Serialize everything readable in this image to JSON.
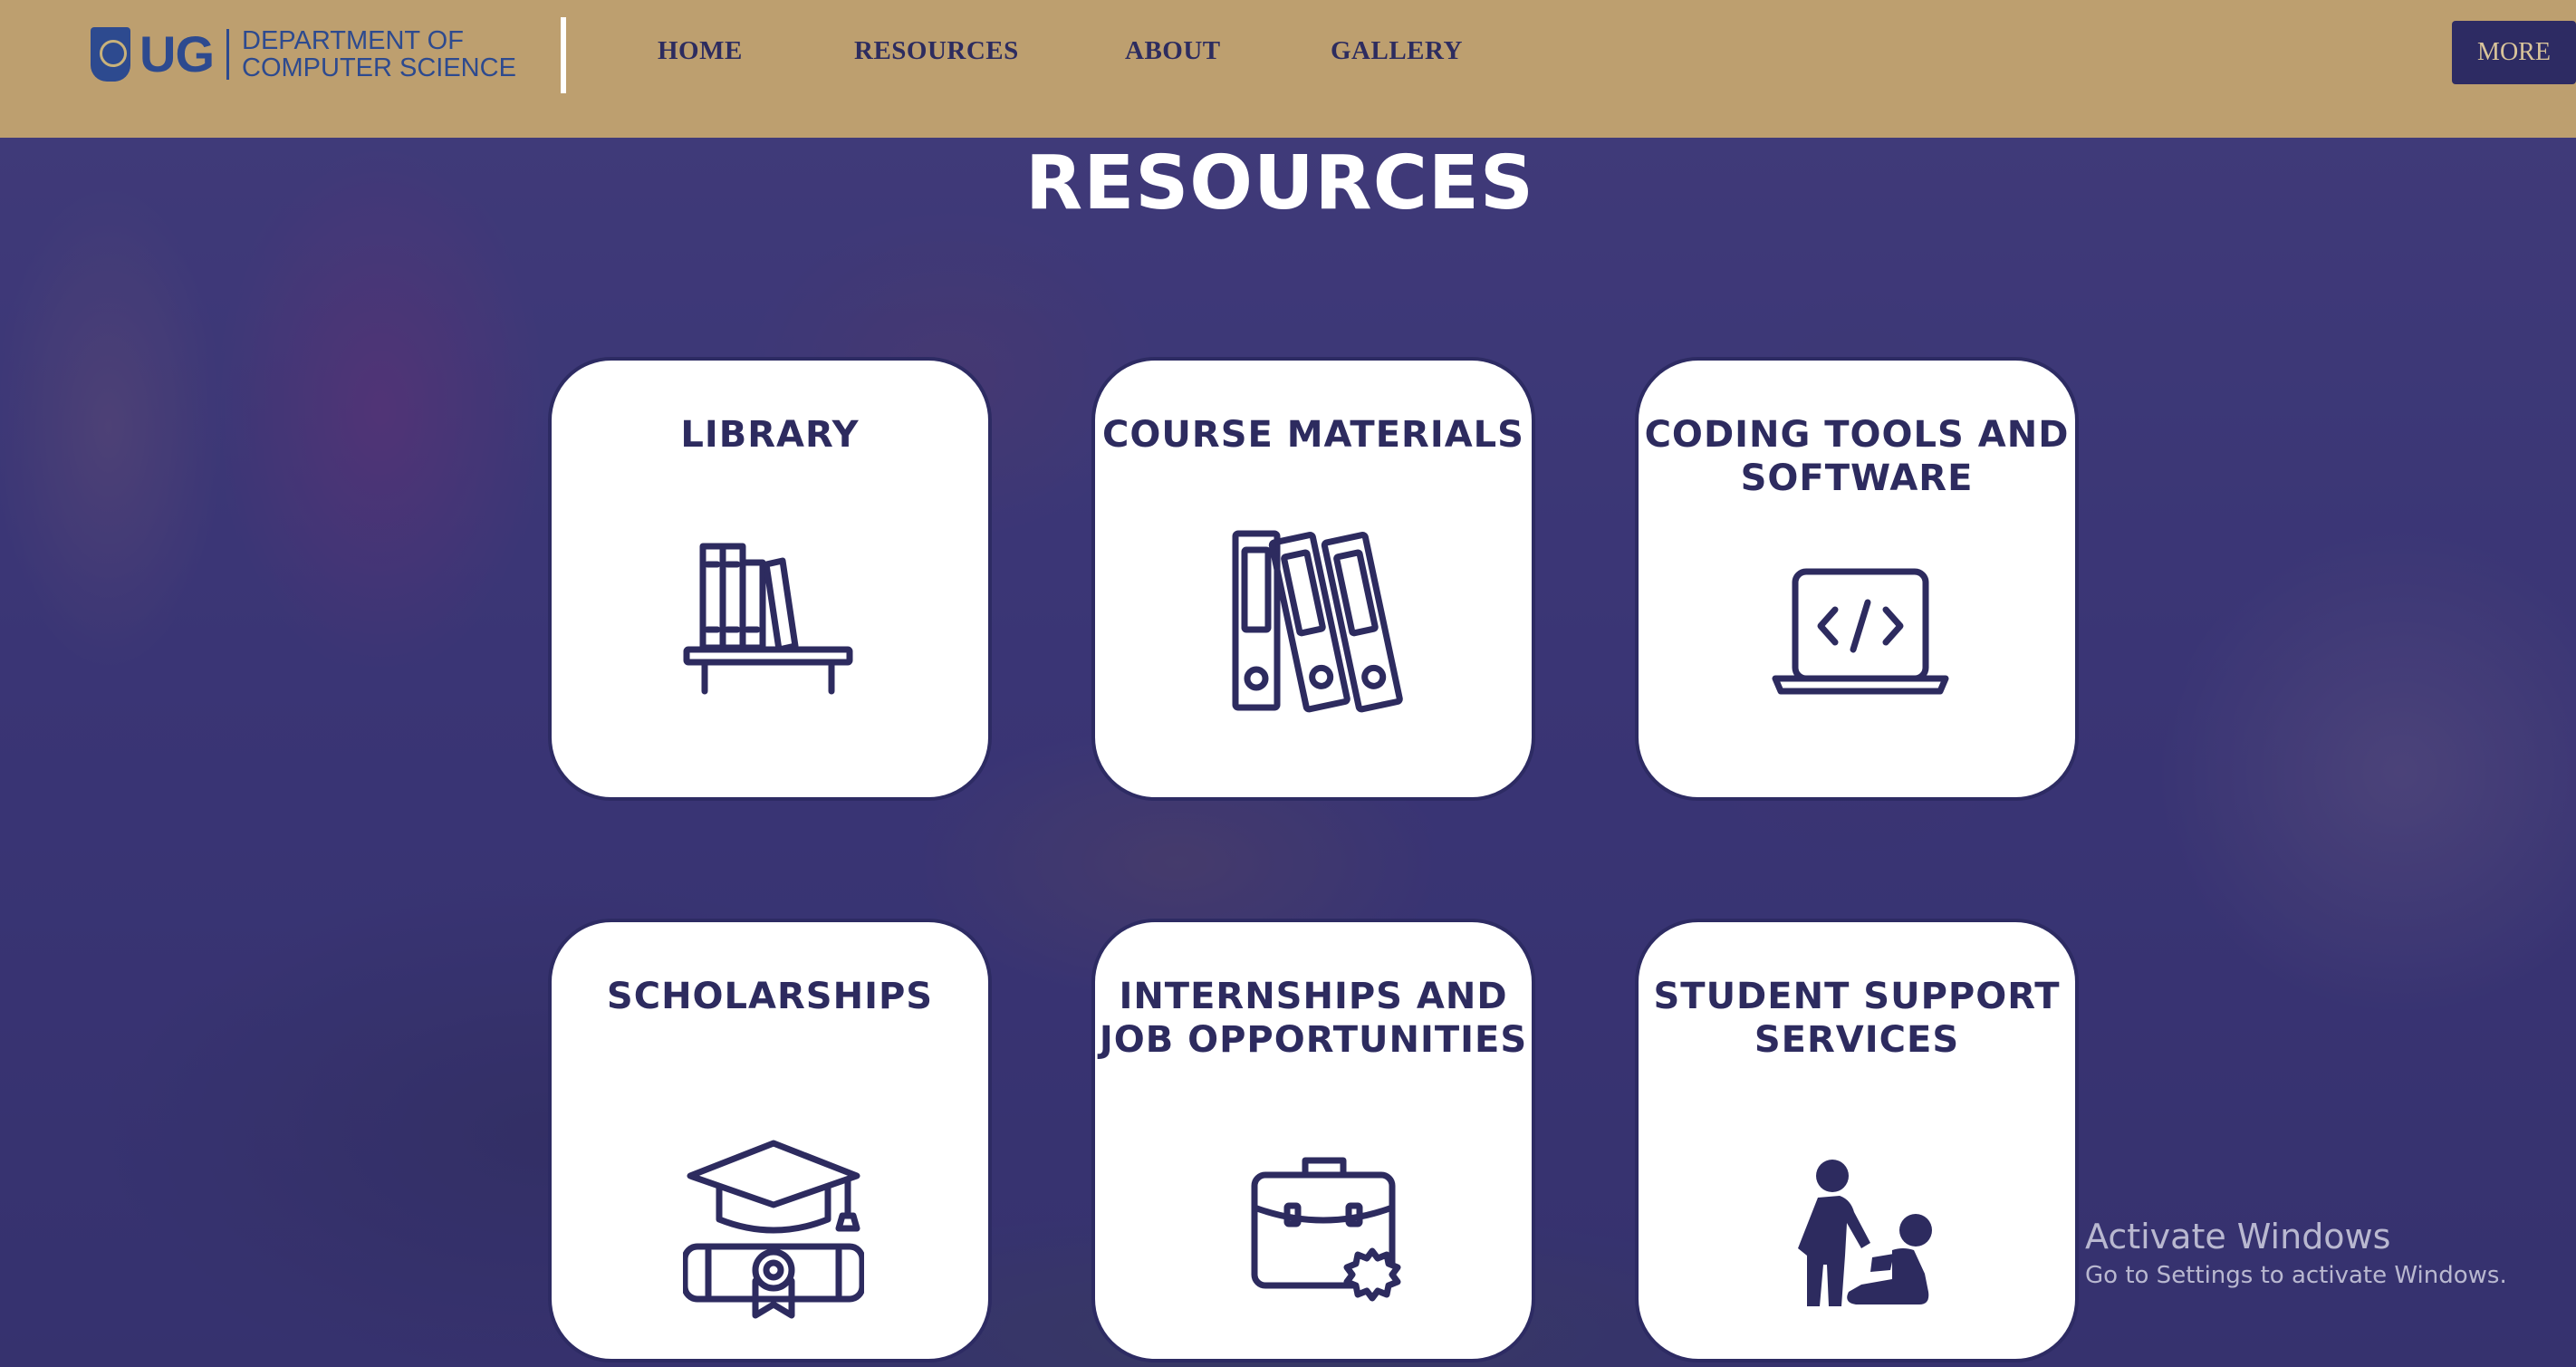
{
  "header": {
    "logo_mark": "UG",
    "logo_text_line1": "DEPARTMENT OF",
    "logo_text_line2": "COMPUTER SCIENCE",
    "nav": [
      {
        "label": "HOME"
      },
      {
        "label": "RESOURCES"
      },
      {
        "label": "ABOUT"
      },
      {
        "label": "GALLERY"
      }
    ],
    "more_label": "MORE"
  },
  "main": {
    "title": "RESOURCES",
    "cards": [
      {
        "title": "LIBRARY",
        "icon": "bookshelf-icon"
      },
      {
        "title": "COURSE MATERIALS",
        "icon": "binders-icon"
      },
      {
        "title": "CODING TOOLS AND\nSOFTWARE",
        "icon": "laptop-code-icon"
      },
      {
        "title": "SCHOLARSHIPS",
        "icon": "graduation-diploma-icon"
      },
      {
        "title": "INTERNSHIPS AND\nJOB OPPORTUNITIES",
        "icon": "briefcase-icon"
      },
      {
        "title": "STUDENT SUPPORT\nSERVICES",
        "icon": "helping-person-icon"
      }
    ]
  },
  "watermark": {
    "title": "Activate Windows",
    "subtitle": "Go to Settings to activate Windows."
  },
  "colors": {
    "header_bg": "#bd9f6f",
    "navy": "#2d2b63",
    "card_bg": "#ffffff",
    "overlay": "#3a3570"
  }
}
